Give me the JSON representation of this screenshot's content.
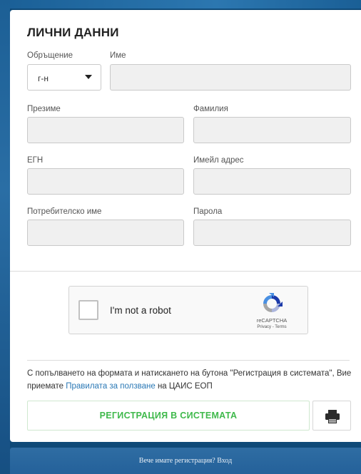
{
  "form": {
    "title": "ЛИЧНИ ДАННИ",
    "salutation": {
      "label": "Обръщение",
      "value": "г-н"
    },
    "first_name": {
      "label": "Име",
      "value": ""
    },
    "middle_name": {
      "label": "Презиме",
      "value": ""
    },
    "last_name": {
      "label": "Фамилия",
      "value": ""
    },
    "egn": {
      "label": "ЕГН",
      "value": ""
    },
    "email": {
      "label": "Имейл адрес",
      "value": ""
    },
    "username": {
      "label": "Потребителско име",
      "value": ""
    },
    "password": {
      "label": "Парола",
      "value": ""
    }
  },
  "recaptcha": {
    "label": "I'm not a robot",
    "brand": "reCAPTCHA",
    "links": "Privacy - Terms"
  },
  "terms": {
    "prefix": "С попълването на формата и натискането на бутона \"Регистрация в системата\", Вие приемате ",
    "link": "Правилата за ползване",
    "suffix": " на ЦАИС ЕОП"
  },
  "actions": {
    "register_label": "РЕГИСТРАЦИЯ В СИСТЕМАТА",
    "print_icon": "printer-icon"
  },
  "footer": {
    "login_text": "Вече имате регистрация? Вход"
  },
  "colors": {
    "background": "#0f4a78",
    "register_text": "#3fb94b",
    "link": "#2a78b5"
  }
}
